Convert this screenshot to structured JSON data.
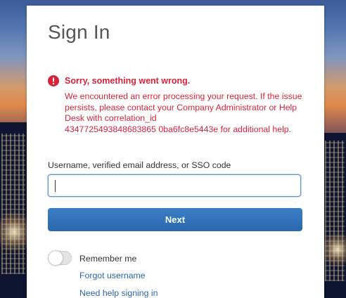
{
  "signin": {
    "title": "Sign In"
  },
  "error": {
    "icon": "error-circle-icon",
    "color": "#d9233a",
    "title": "Sorry, something went wrong.",
    "lines": [
      "We encountered an error processing your request. If the issue",
      "persists, please contact your Company Administrator or Help",
      "Desk with correlation_id",
      "4347725493848683865 0ba6fc8e5443e for additional help."
    ]
  },
  "username": {
    "label": "Username, verified email address, or SSO code",
    "value": "",
    "placeholder": ""
  },
  "next": {
    "label": "Next",
    "color": "#2f6fb5"
  },
  "remember": {
    "label": "Remember me",
    "checked": false
  },
  "links": {
    "forgot_username": "Forgot username",
    "need_help": "Need help signing in"
  }
}
